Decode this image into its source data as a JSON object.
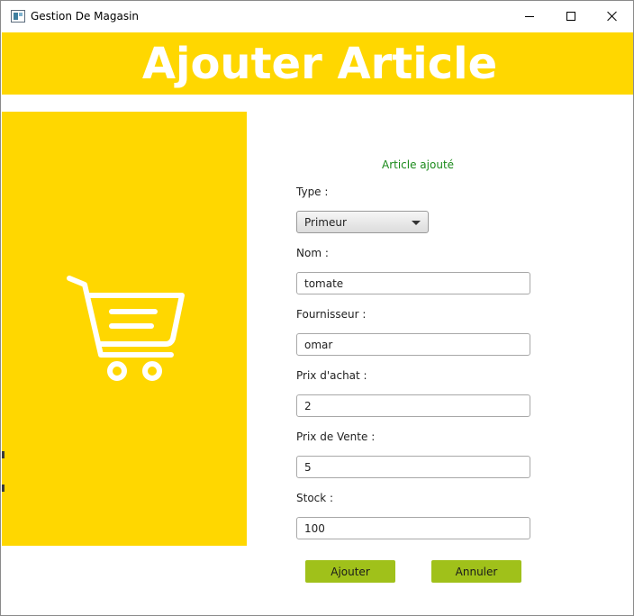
{
  "window": {
    "title": "Gestion De Magasin",
    "icon": "app-window-icon"
  },
  "header": {
    "title": "Ajouter Article",
    "background": "#ffd700"
  },
  "side_panel": {
    "icon": "shopping-cart-icon"
  },
  "form": {
    "status": "Article ajouté",
    "status_color": "#1a8a1a",
    "type_label": "Type :",
    "type_value": "Primeur",
    "nom_label": "Nom :",
    "nom_value": "tomate",
    "fournisseur_label": "Fournisseur :",
    "fournisseur_value": "omar",
    "prix_achat_label": "Prix d'achat :",
    "prix_achat_value": "2",
    "prix_vente_label": "Prix de Vente :",
    "prix_vente_value": "5",
    "stock_label": "Stock :",
    "stock_value": "100"
  },
  "actions": {
    "add_label": "Ajouter",
    "cancel_label": "Annuler",
    "button_color": "#a0c11a"
  }
}
